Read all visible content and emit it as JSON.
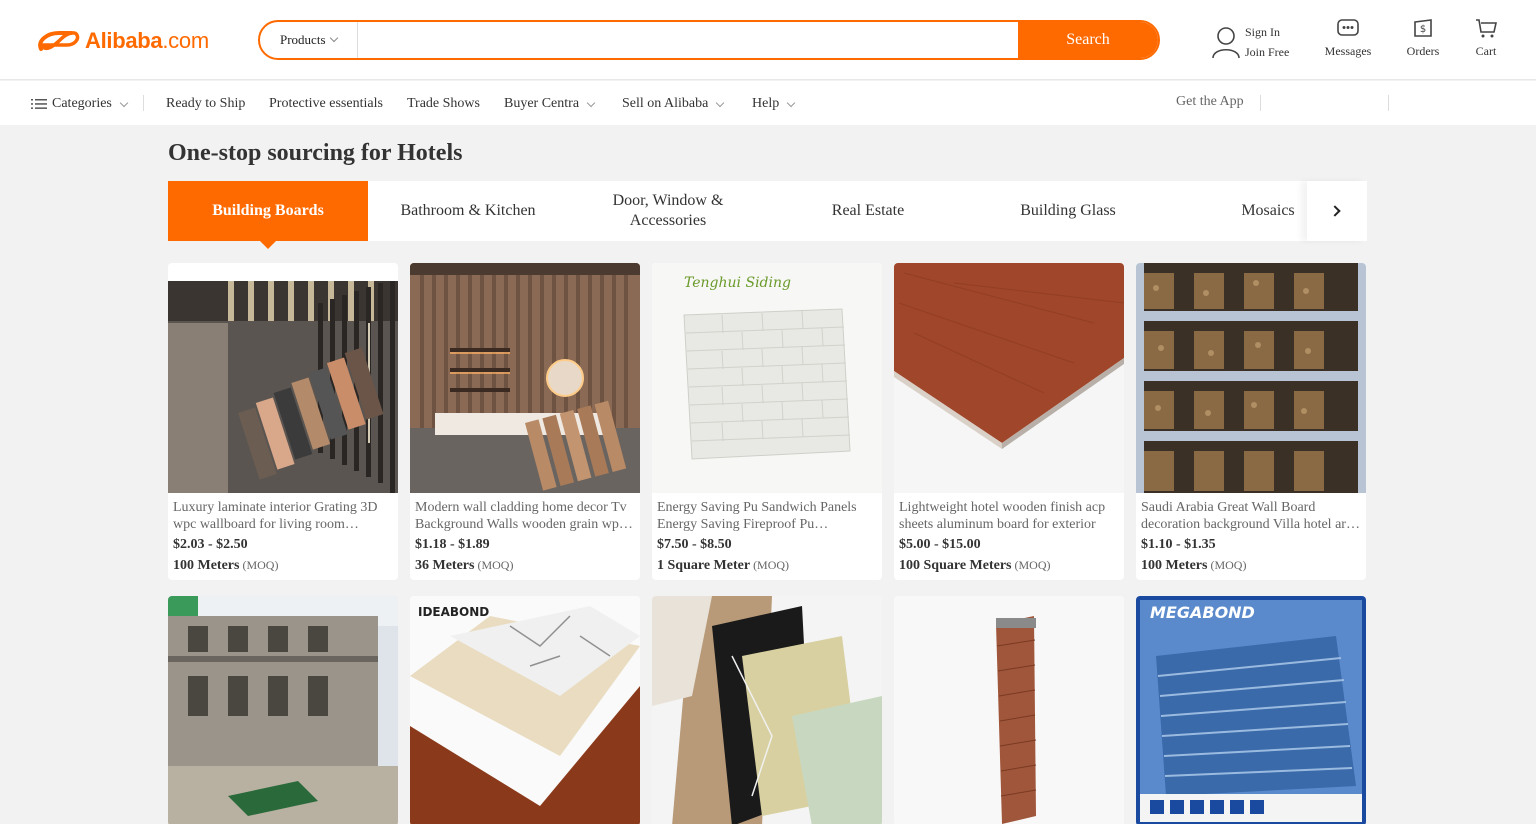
{
  "header": {
    "logo_text": "Alibaba",
    "logo_suffix": ".com",
    "search_category": "Products",
    "search_placeholder": "",
    "search_button": "Search",
    "sign_in": "Sign In",
    "join_free": "Join Free",
    "messages": "Messages",
    "orders": "Orders",
    "cart": "Cart"
  },
  "nav": {
    "categories": "Categories",
    "items": [
      "Ready to Ship",
      "Protective essentials",
      "Trade Shows",
      "Buyer Centra",
      "Sell on Alibaba",
      "Help"
    ],
    "get_app": "Get the App"
  },
  "main": {
    "title": "One-stop sourcing for Hotels",
    "tabs": [
      "Building Boards",
      "Bathroom & Kitchen",
      "Door, Window & Accessories",
      "Real Estate",
      "Building Glass",
      "Mosaics"
    ],
    "active_tab": 0,
    "products": [
      {
        "title": "Luxury laminate interior Grating 3D wpc wallboard for living room decoration",
        "price": "$2.03 - $2.50",
        "moq": "100 Meters",
        "moq_label": "(MOQ)"
      },
      {
        "title": "Modern wall cladding home decor Tv Background Walls wooden grain wpc panel",
        "price": "$1.18 - $1.89",
        "moq": "36 Meters",
        "moq_label": "(MOQ)"
      },
      {
        "title": "Energy Saving Pu Sandwich Panels Energy Saving Fireproof Pu Decorative Panel",
        "price": "$7.50 - $8.50",
        "moq": "1 Square Meter",
        "moq_label": "(MOQ)"
      },
      {
        "title": "Lightweight hotel wooden finish acp sheets aluminum board for exterior",
        "price": "$5.00 - $15.00",
        "moq": "100 Square Meters",
        "moq_label": "(MOQ)"
      },
      {
        "title": "Saudi Arabia Great Wall Board decoration background Villa hotel art wall panel",
        "price": "$1.10 - $1.35",
        "moq": "100 Meters",
        "moq_label": "(MOQ)"
      }
    ],
    "image_labels": [
      "Tenghui Siding",
      "IDEABOND",
      "MEGABOND"
    ]
  },
  "colors": {
    "accent": "#ff6a00",
    "background": "#f2f2f2"
  }
}
